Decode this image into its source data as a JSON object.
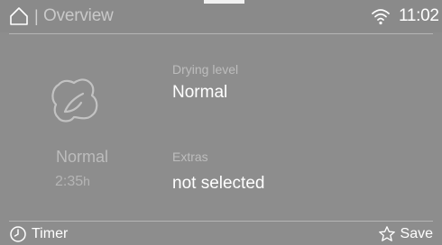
{
  "header": {
    "title": "Overview",
    "separator": "|",
    "time": "11:02",
    "home_icon": "home-icon",
    "wifi_icon": "wifi-icon"
  },
  "program": {
    "icon": "leaf-program-icon",
    "name": "Normal",
    "duration_value": "2:35",
    "duration_unit": "h"
  },
  "settings": {
    "drying_level": {
      "label": "Drying level",
      "value": "Normal"
    },
    "extras": {
      "label": "Extras",
      "value": "not selected"
    }
  },
  "footer": {
    "timer_label": "Timer",
    "timer_icon": "clock-icon",
    "save_label": "Save",
    "save_icon": "star-icon"
  },
  "colors": {
    "background": "#8d8d8d",
    "text_primary": "#ffffff",
    "text_secondary": "#bdbdbd",
    "divider": "#b5b5b5"
  }
}
